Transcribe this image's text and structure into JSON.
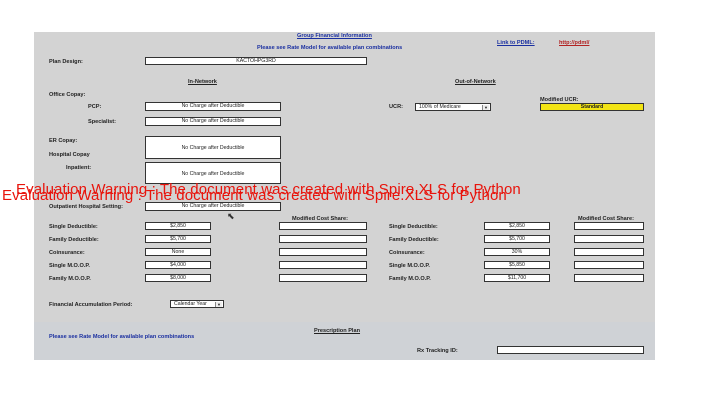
{
  "header": {
    "title": "Group Financial Information",
    "subtitle": "Please see Rate Model for available plan combinations",
    "pdml_label": "Link to PDML:",
    "pdml_link": "http://pdml/"
  },
  "plan_design": {
    "label": "Plan Design:",
    "value": "KACTOHPG3RD"
  },
  "in_network": {
    "heading": "In-Network",
    "office_copay": "Office Copay:",
    "pcp_label": "PCP:",
    "pcp_value": "No Charge after Deductible",
    "specialist_label": "Specialist:",
    "specialist_value": "No Charge after Deductible",
    "er_label": "ER Copay:",
    "er_value": "No Charge after Deductible",
    "hospital_copay": "Hospital Copay",
    "inpatient_label": "Inpatient:",
    "inpatient_value": "No Charge after Deductible",
    "outpatient_label": "Outpatient Hospital Setting:",
    "outpatient_value": "No Charge after Deductible",
    "single_ded_label": "Single Deductible:",
    "single_ded": "$2,850",
    "family_ded_label": "Family Deductible:",
    "family_ded": "$5,700",
    "coins_label": "Coinsurance:",
    "coins": "None",
    "single_moop_label": "Single M.O.O.P.",
    "single_moop": "$4,000",
    "family_moop_label": "Family M.O.O.P.",
    "family_moop": "$8,000",
    "modified_label": "Modified Cost Share:"
  },
  "out_network": {
    "heading": "Out-of-Network",
    "ucr_label": "UCR:",
    "ucr_value": "100% of Medicare",
    "modified_ucr_label": "Modified UCR:",
    "modified_ucr_value": "Standard",
    "single_ded_label": "Single Deductible:",
    "single_ded": "$2,850",
    "family_ded_label": "Family Deductible:",
    "family_ded": "$5,700",
    "coins_label": "Coinsurance:",
    "coins": "30%",
    "single_moop_label": "Single M.O.O.P.",
    "single_moop": "$5,850",
    "family_moop_label": "Family M.O.O.P.",
    "family_moop": "$11,700",
    "modified_label": "Modified Cost Share:"
  },
  "accumulation": {
    "label": "Financial Accumulation Period:",
    "value": "Calendar Year"
  },
  "prescription": {
    "title": "Prescription Plan",
    "note": "Please see Rate Model for available plan combinations",
    "rx_label": "Rx Tracking ID:"
  },
  "watermark": "Evaluation Warning : The document was created with  Spire.XLS for Python"
}
